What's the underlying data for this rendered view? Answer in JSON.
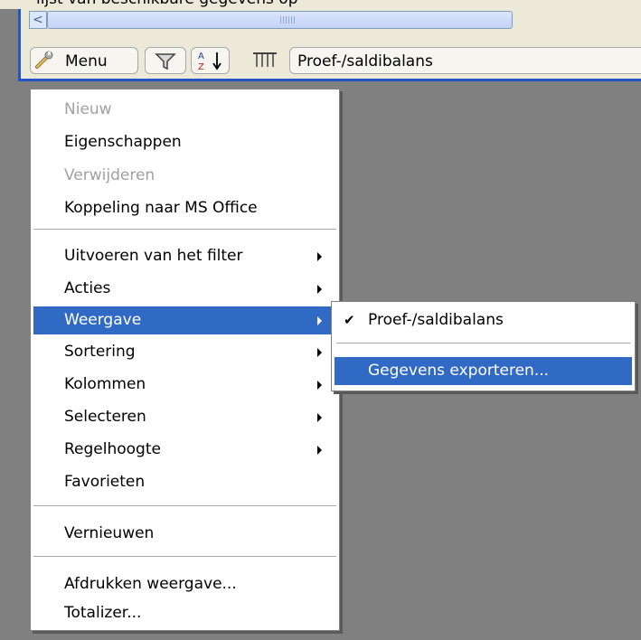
{
  "header_cropped_text": "lijst van beschikbare gegevens op",
  "toolbar": {
    "scroll_left_label": "<",
    "menu_label": "Menu",
    "filter_icon": "funnel-icon",
    "sort_icon": "az-sort-icon",
    "columns_icon": "columns-icon",
    "view_name": "Proef-/saldibalans"
  },
  "menu": {
    "items": [
      {
        "label": "Nieuw",
        "disabled": true
      },
      {
        "label": "Eigenschappen"
      },
      {
        "label": "Verwijderen",
        "disabled": true
      },
      {
        "label": "Koppeling naar MS Office"
      },
      {
        "label": "Uitvoeren van het filter",
        "submenu": true
      },
      {
        "label": "Acties",
        "submenu": true
      },
      {
        "label": "Weergave",
        "submenu": true,
        "selected": true
      },
      {
        "label": "Sortering",
        "submenu": true
      },
      {
        "label": "Kolommen",
        "submenu": true
      },
      {
        "label": "Selecteren",
        "submenu": true
      },
      {
        "label": "Regelhoogte",
        "submenu": true
      },
      {
        "label": "Favorieten"
      },
      {
        "label": "Vernieuwen"
      },
      {
        "label": "Afdrukken weergave..."
      },
      {
        "label": "Totalizer..."
      }
    ]
  },
  "submenu": {
    "items": [
      {
        "label": "Proef-/saldibalans",
        "checked": true
      },
      {
        "label": "Gegevens exporteren...",
        "selected": true
      }
    ]
  },
  "colors": {
    "highlight": "#316ac5",
    "window_border": "#2454c5",
    "background": "#808080"
  }
}
